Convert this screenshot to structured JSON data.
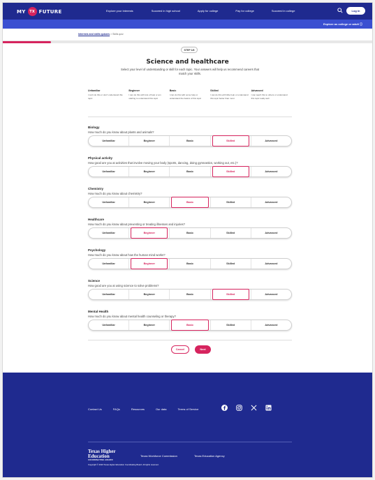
{
  "header": {
    "logo_left": "MY",
    "logo_badge": "TX",
    "logo_right": "FUTURE",
    "nav": [
      "Explore your interests",
      "Succeed in high school",
      "Apply for college",
      "Pay for college",
      "Succeed in college"
    ],
    "login_label": "Log in",
    "explore_label": "Explore as college or adult ⓘ",
    "icons": {
      "search": "search-icon"
    }
  },
  "breadcrumb": {
    "item1": "Interests and skills quizzes",
    "separator": " > ",
    "item2": "Skills quiz"
  },
  "progress": {
    "fraction": 0.13,
    "color": "#d6245e"
  },
  "quiz": {
    "step_label": "STEP 1/6",
    "title": "Science and healthcare",
    "subtitle": "Select your level of understanding or skill for each topic. Your answers will help us recommend careers that match your skills.",
    "legend": [
      {
        "label": "Unfamiliar",
        "desc": "I can't do this or don't understand this topic"
      },
      {
        "label": "Beginner",
        "desc": "I can do this with lots of help or am starting to understand this topic"
      },
      {
        "label": "Basic",
        "desc": "I can do this with some help or understand the basics of this topic"
      },
      {
        "label": "Skilled",
        "desc": "I can do this with little help or understand this topic better than most"
      },
      {
        "label": "Advanced",
        "desc": "I can teach this to others or understand this topic really well"
      }
    ],
    "options": [
      "Unfamiliar",
      "Beginner",
      "Basic",
      "Skilled",
      "Advanced"
    ],
    "questions": [
      {
        "name": "Biology",
        "text": "How much do you know about plants and animals?",
        "selected": "Skilled"
      },
      {
        "name": "Physical activity",
        "text": "How good are you at activities that involve moving your body (sports, dancing, doing gymnastics, working out, etc.)?",
        "selected": "Skilled"
      },
      {
        "name": "Chemistry",
        "text": "How much do you know about chemistry?",
        "selected": "Basic"
      },
      {
        "name": "Healthcare",
        "text": "How much do you know about preventing or treating illnesses and injuries?",
        "selected": "Beginner"
      },
      {
        "name": "Psychology",
        "text": "How much do you know about how the human mind works?",
        "selected": "Beginner"
      },
      {
        "name": "Science",
        "text": "How good are you at using science to solve problems?",
        "selected": "Skilled"
      },
      {
        "name": "Mental Health",
        "text": "How much do you know about mental health counseling or therapy?",
        "selected": "Basic"
      }
    ],
    "cancel_label": "Cancel",
    "next_label": "Next"
  },
  "footer": {
    "links": [
      "Contact Us",
      "FAQs",
      "Resources",
      "Our data",
      "Terms of Service"
    ],
    "social_icons": [
      "facebook-icon",
      "instagram-icon",
      "x-icon",
      "linkedin-icon"
    ],
    "thecb_line1": "Texas Higher",
    "thecb_line2": "Education",
    "thecb_line3": "COORDINATING BOARD",
    "twc": "Texas Workforce Commission",
    "tea": "Texas Education Agency",
    "copyright": "Copyright © 2023 Texas Higher Education Coordinating Board. All rights reserved."
  },
  "colors": {
    "brand_navy": "#1f2a8f",
    "accent_pink": "#d6245e",
    "subbar_blue": "#3a4fd1"
  }
}
